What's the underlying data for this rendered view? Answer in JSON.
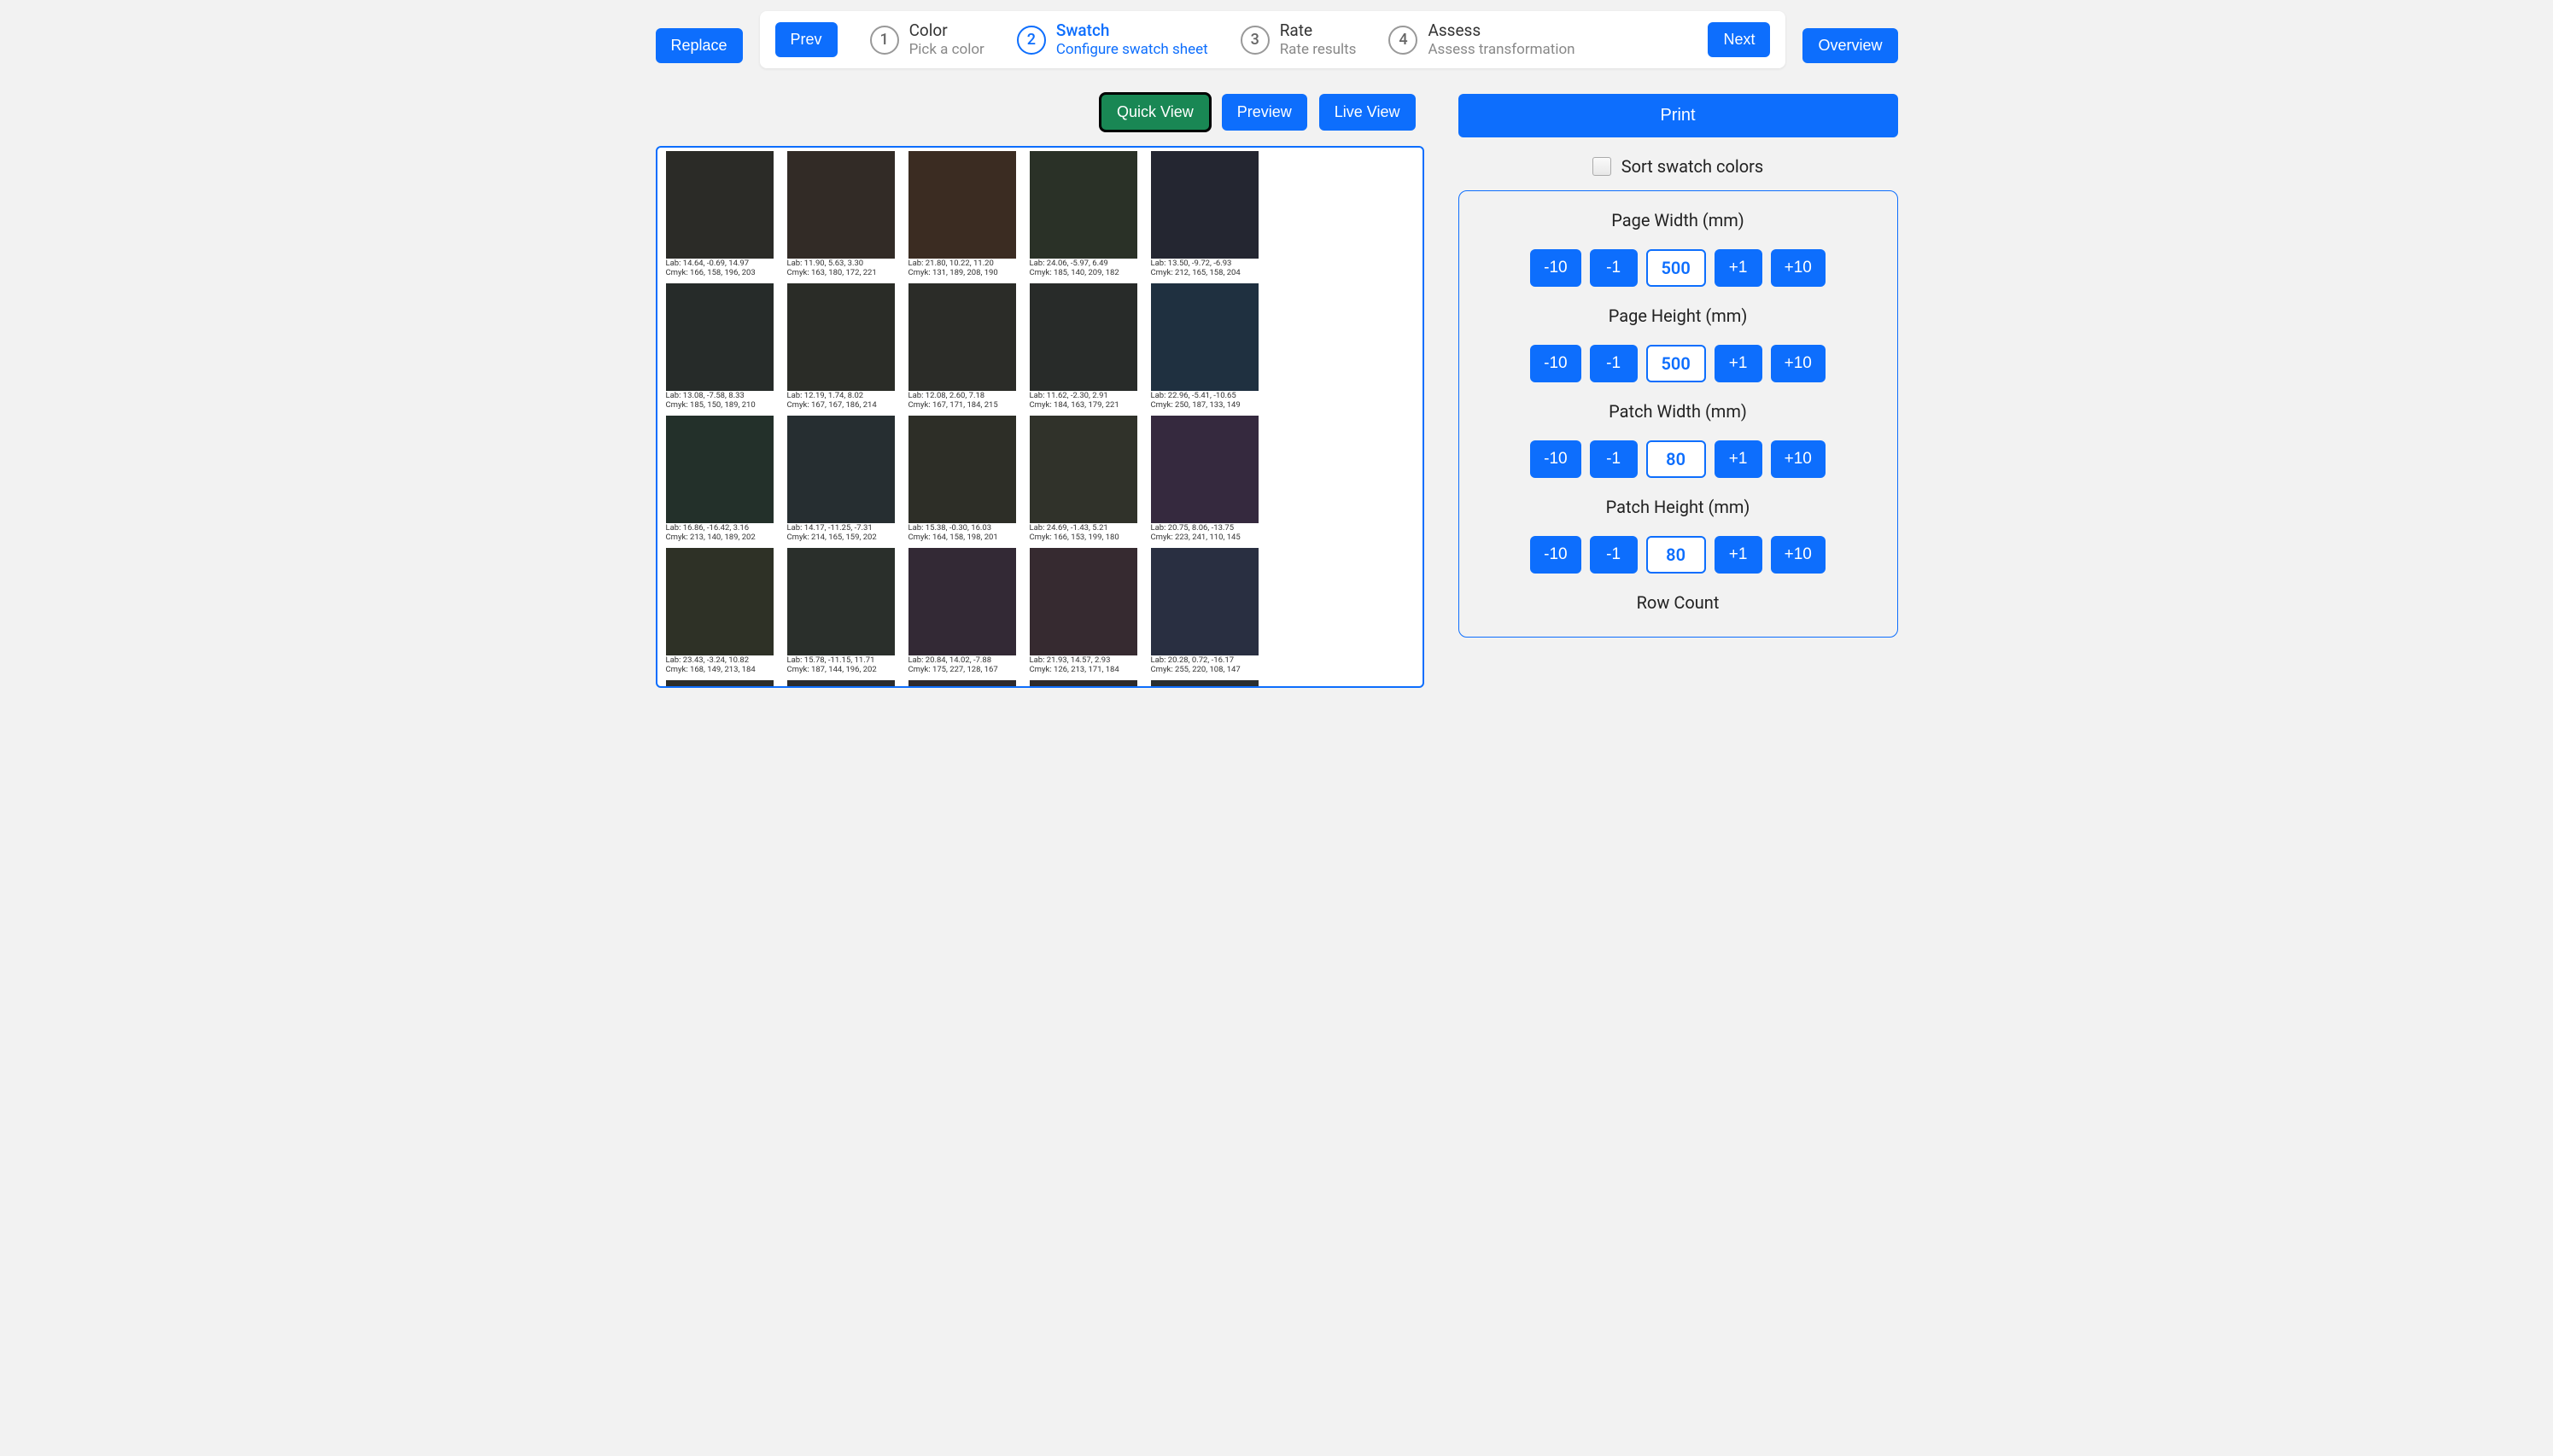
{
  "top": {
    "replace": "Replace",
    "overview": "Overview",
    "prev": "Prev",
    "next": "Next"
  },
  "steps": [
    {
      "num": "1",
      "title": "Color",
      "sub": "Pick a color",
      "active": false
    },
    {
      "num": "2",
      "title": "Swatch",
      "sub": "Configure swatch sheet",
      "active": true
    },
    {
      "num": "3",
      "title": "Rate",
      "sub": "Rate results",
      "active": false
    },
    {
      "num": "4",
      "title": "Assess",
      "sub": "Assess transformation",
      "active": false
    }
  ],
  "viewButtons": {
    "quick": "Quick View",
    "preview": "Preview",
    "live": "Live View"
  },
  "right": {
    "print": "Print",
    "sort_label": "Sort swatch colors",
    "params": [
      {
        "label": "Page Width (mm)",
        "value": "500"
      },
      {
        "label": "Page Height (mm)",
        "value": "500"
      },
      {
        "label": "Patch Width (mm)",
        "value": "80"
      },
      {
        "label": "Patch Height (mm)",
        "value": "80"
      },
      {
        "label": "Row Count",
        "value": ""
      }
    ],
    "stepper": {
      "m10": "-10",
      "m1": "-1",
      "p1": "+1",
      "p10": "+10"
    }
  },
  "swatches": [
    {
      "color": "#2b2b27",
      "lab": "Lab: 14.64, -0.69, 14.97",
      "cmyk": "Cmyk: 166, 158, 196, 203"
    },
    {
      "color": "#322b26",
      "lab": "Lab: 11.90, 5.63, 3.30",
      "cmyk": "Cmyk: 163, 180, 172, 221"
    },
    {
      "color": "#3b2c22",
      "lab": "Lab: 21.80, 10.22, 11.20",
      "cmyk": "Cmyk: 131, 189, 208, 190"
    },
    {
      "color": "#2a3127",
      "lab": "Lab: 24.06, -5.97, 6.49",
      "cmyk": "Cmyk: 185, 140, 209, 182"
    },
    {
      "color": "#242631",
      "lab": "Lab: 13.50, -9.72, -6.93",
      "cmyk": "Cmyk: 212, 165, 158, 204"
    },
    {
      "color": "#262b29",
      "lab": "Lab: 13.08, -7.58, 8.33",
      "cmyk": "Cmyk: 185, 150, 189, 210"
    },
    {
      "color": "#2a2c27",
      "lab": "Lab: 12.19, 1.74, 8.02",
      "cmyk": "Cmyk: 167, 167, 186, 214"
    },
    {
      "color": "#2b2c28",
      "lab": "Lab: 12.08, 2.60, 7.18",
      "cmyk": "Cmyk: 167, 171, 184, 215"
    },
    {
      "color": "#282b29",
      "lab": "Lab: 11.62, -2.30, 2.91",
      "cmyk": "Cmyk: 184, 163, 179, 221"
    },
    {
      "color": "#1f3040",
      "lab": "Lab: 22.96, -5.41, -10.65",
      "cmyk": "Cmyk: 250, 187, 133, 149"
    },
    {
      "color": "#23302a",
      "lab": "Lab: 16.86, -16.42, 3.16",
      "cmyk": "Cmyk: 213, 140, 189, 202"
    },
    {
      "color": "#262e31",
      "lab": "Lab: 14.17, -11.25, -7.31",
      "cmyk": "Cmyk: 214, 165, 159, 202"
    },
    {
      "color": "#2d2e27",
      "lab": "Lab: 15.38, -0.30, 16.03",
      "cmyk": "Cmyk: 164, 158, 198, 201"
    },
    {
      "color": "#30322a",
      "lab": "Lab: 24.69, -1.43, 5.21",
      "cmyk": "Cmyk: 166, 153, 199, 180"
    },
    {
      "color": "#35293e",
      "lab": "Lab: 20.75, 8.06, -13.75",
      "cmyk": "Cmyk: 223, 241, 110, 145"
    },
    {
      "color": "#2e3126",
      "lab": "Lab: 23.43, -3.24, 10.82",
      "cmyk": "Cmyk: 168, 149, 213, 184"
    },
    {
      "color": "#2a2f2b",
      "lab": "Lab: 15.78, -11.15, 11.71",
      "cmyk": "Cmyk: 187, 144, 196, 202"
    },
    {
      "color": "#332935",
      "lab": "Lab: 20.84, 14.02, -7.88",
      "cmyk": "Cmyk: 175, 227, 128, 167"
    },
    {
      "color": "#362a30",
      "lab": "Lab: 21.93, 14.57, 2.93",
      "cmyk": "Cmyk: 126, 213, 171, 184"
    },
    {
      "color": "#292f41",
      "lab": "Lab: 20.28, 0.72, -16.17",
      "cmyk": "Cmyk: 255, 220, 108, 147"
    },
    {
      "color": "#2d2e2a",
      "lab": "",
      "cmyk": ""
    },
    {
      "color": "#2b2c2e",
      "lab": "",
      "cmyk": ""
    },
    {
      "color": "#2e2a2d",
      "lab": "",
      "cmyk": ""
    },
    {
      "color": "#2f2b2a",
      "lab": "",
      "cmyk": ""
    },
    {
      "color": "#2a2e2f",
      "lab": "",
      "cmyk": ""
    }
  ]
}
